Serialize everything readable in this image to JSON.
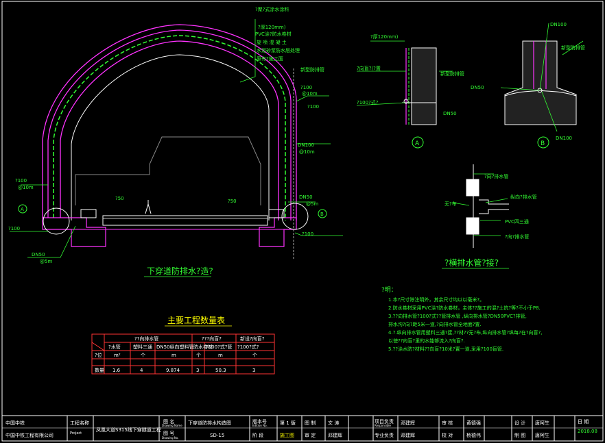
{
  "colors": {
    "background": "#000000",
    "lining": "#ff33ff",
    "waterproof": "#33ff33",
    "outline": "#ffffff",
    "annotation": "#33ff33",
    "table_border": "#ff3333",
    "frame": "#ffffff"
  },
  "main_section": {
    "title": "下穿道防排水?造?",
    "labels": {
      "membrane_1": "?聚?式涂水涂料",
      "membrane_2": "?厚120mm)",
      "membrane_3": "PVC涂?防水卷材",
      "membrane_4": "旋 喷 混 凝 土",
      "membrane_5": "水泥砂浆防水层处理",
      "membrane_6": "原有?施工面",
      "cap": "新型防排管",
      "pipe_top_1": "?100",
      "pipe_top_2": "@10m",
      "pipe_top_3": "?100",
      "dn100_1": "DN100",
      "dn100_2": "@10m",
      "left_pipe_1": "?100",
      "left_pipe_2": "@10m",
      "left_drain": "?100",
      "dn50_left_1": "DN50",
      "dn50_left_2": "@5m",
      "phi50_left": "?50",
      "phi50_right": "?50",
      "dn50_right_1": "DN50",
      "dn50_right_2": "@5m",
      "right_drain": "?100",
      "marker_a": "A",
      "marker_b": "B"
    }
  },
  "detail_a": {
    "marker": "A",
    "labels": {
      "l1": "?厚120mm)",
      "l2": "?向盲?(?置",
      "l3": "?100?式?",
      "l4": "DN50",
      "r1": "新型防排管"
    }
  },
  "detail_b": {
    "marker": "B",
    "labels": {
      "l1": "DN100",
      "l2": "DN50",
      "l3": "DN100",
      "r1": "新型防排管"
    }
  },
  "detail_c": {
    "title": "?横排水管?接?",
    "labels": {
      "l1": "?向?排水管",
      "l2": "纵向?排水管",
      "l3": "无?布",
      "l4": "PVC四三通",
      "l5": "?向?排水管"
    }
  },
  "notes": {
    "heading": "?明：",
    "lines": [
      "1.本?尺寸除注明外，其余尺寸均以以毫米?。",
      "2.防水卷材采用PVC涂?防水卷材，主体??施工的混?土抗?等?不小于P8.",
      "3.??向排水管?100?式??管排水管  ,纵向排水管?DN50PVC?排管,",
      "排水沟?向?距5米一道,?向排水管全地面?置.",
      "4.?.纵向排水管用塑料三通?接,??材??无?布,纵向排水管?纵每?在?向盲?,",
      "以使??向盲?里的水能够流入?向盲?.",
      "5.??涂水防?材料??向盲?10米?置一道,采用?100盲管."
    ]
  },
  "table": {
    "title": "主要工程数量表",
    "group_headers": [
      "??向排水管",
      "???向盲?",
      "新设?向盲?"
    ],
    "columns": [
      "?水管",
      "塑料三通",
      "DN50纵向塑料管",
      "防水卷材",
      "?100?式?管",
      "?100?式?"
    ],
    "row_header_label": "?位",
    "units": [
      "m²",
      "个",
      "m",
      "个",
      "m",
      "个"
    ],
    "row_label": "数量",
    "values": [
      "1.6",
      "4",
      "9.874",
      "3",
      "50.3",
      "3"
    ]
  },
  "title_block": {
    "company_short": "中国中铁",
    "company": "中国中铁工程有限公司",
    "project_label": "工程名称",
    "project_label_en": "Project",
    "project_name": "凤凰大道S315线下穿隧道工程",
    "drawing_label": "图 名",
    "drawing_label_en": "Drawing Name",
    "drawing_name": "下穿道防排水构造图",
    "drawing_no_label": "图 号",
    "drawing_no_label_en": "Drawing No.",
    "drawing_no": "SD-15",
    "version_label": "版本号",
    "version_label_en": "Edition No.",
    "version_value": "第 1 版",
    "stage_label": "阶 段",
    "stage_value": "施工图",
    "drafter_label": "图 制",
    "drafter_value": "文 涛",
    "reviewer_label": "审 定",
    "reviewer_value": "邓建辉",
    "pm_label": "项目负责",
    "pm_label_en": "Responsible",
    "pm_value": "邓建辉",
    "checker_label": "审 核",
    "checker_value": "黄德强",
    "specialty_label": "专业负责",
    "specialty_value": "邓建辉",
    "verifier_label": "校 对",
    "verifier_value": "杨德伟",
    "designer_label": "设 计",
    "designer_value": "唐阿生",
    "draw_label": "制 图",
    "draw_value": "唐阿生",
    "date_label": "日 期",
    "date_value": "2018.08"
  }
}
